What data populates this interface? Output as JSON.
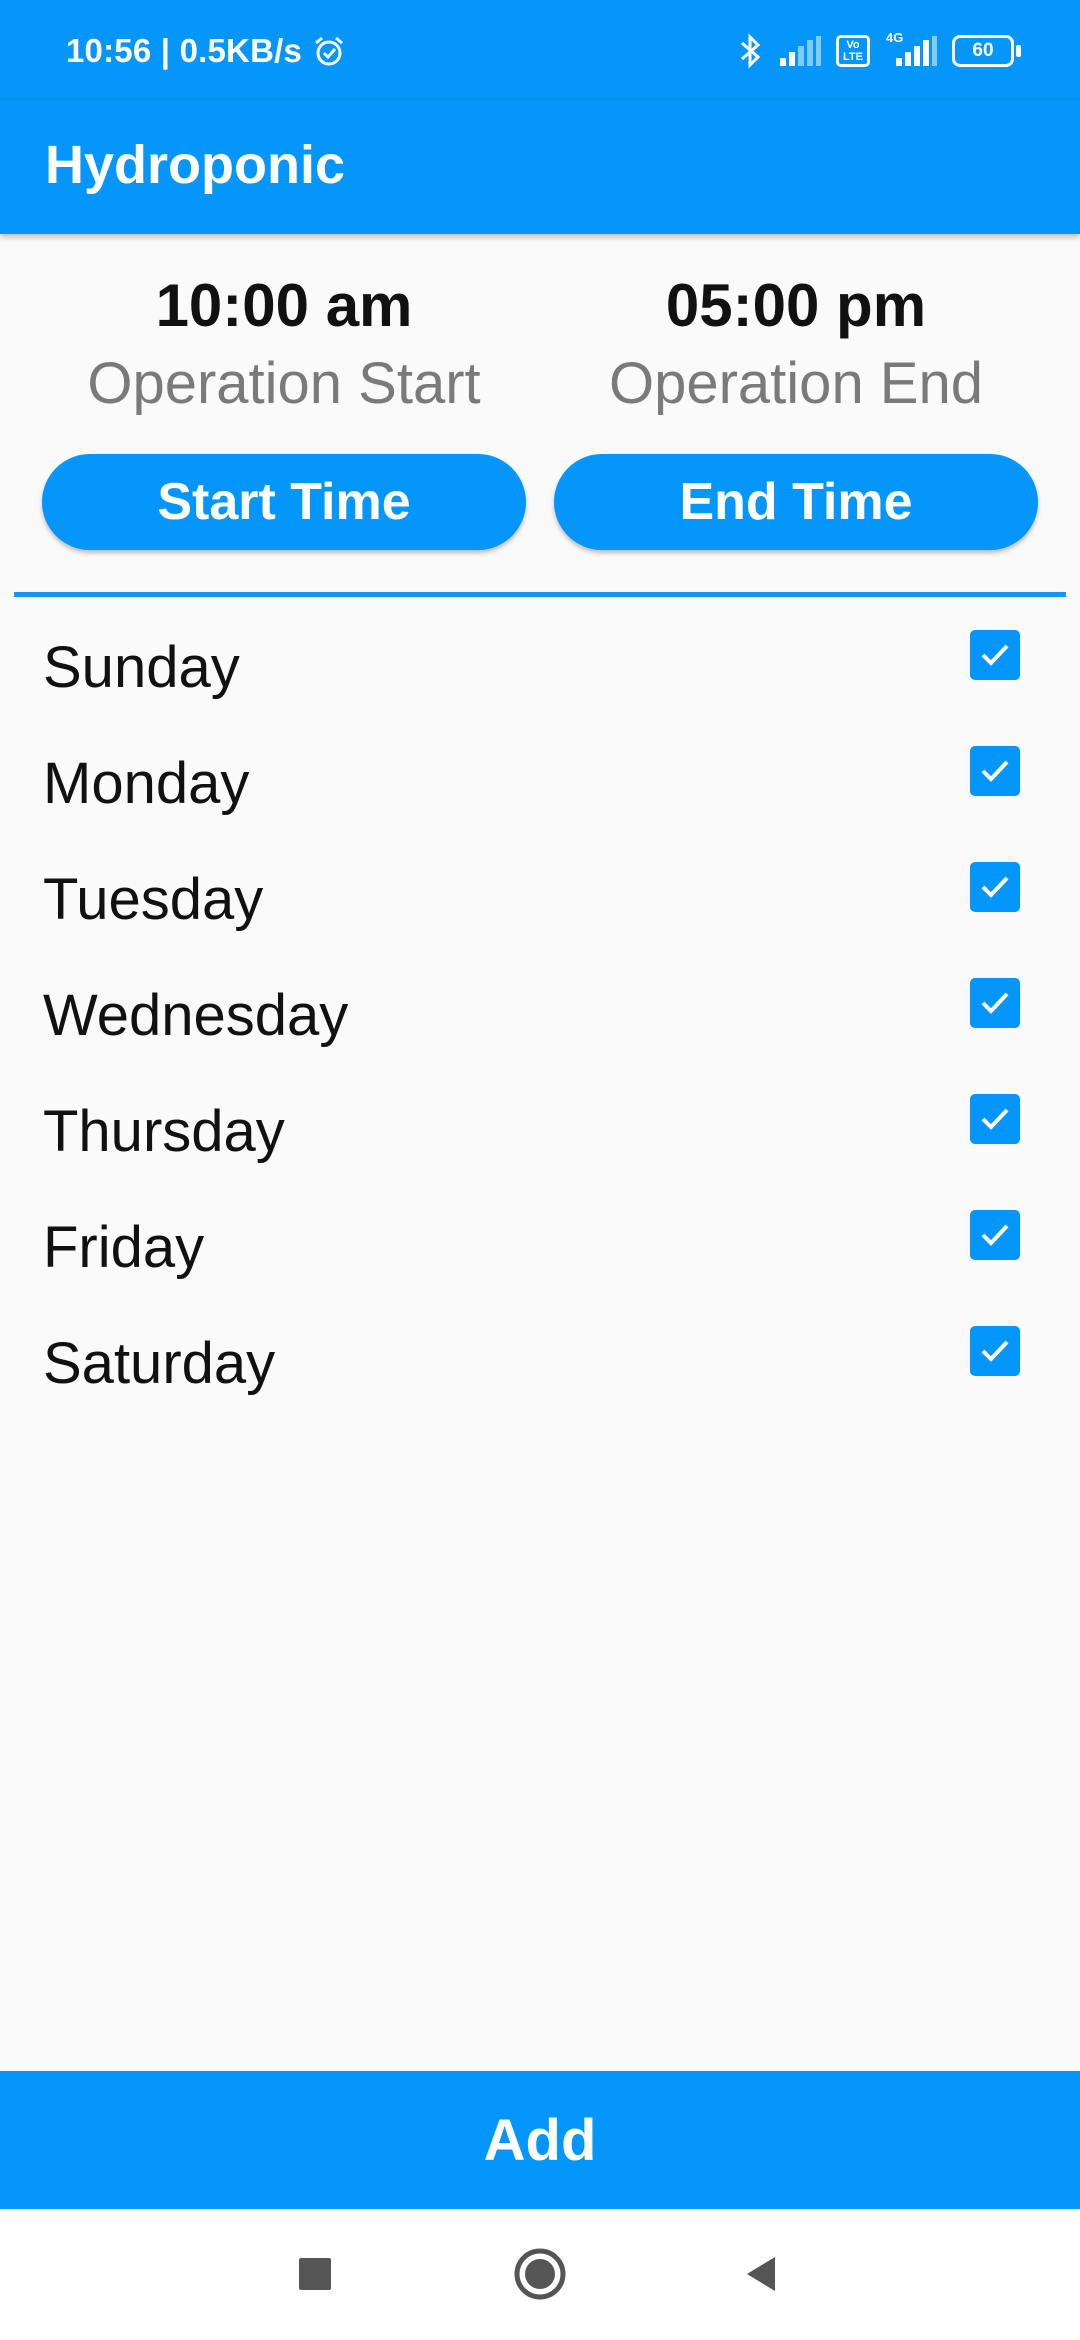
{
  "status_bar": {
    "time_speed": "10:56 | 0.5KB/s",
    "network_4g": "4G",
    "volte": "Vo LTE",
    "battery": "60",
    "icons": [
      "alarm-icon",
      "bluetooth-icon",
      "signal-icon",
      "volte-icon",
      "signal-4g-icon",
      "battery-icon"
    ]
  },
  "app_bar": {
    "title": "Hydroponic"
  },
  "schedule": {
    "start_time": "10:00 am",
    "start_caption": "Operation Start",
    "end_time": "05:00 pm",
    "end_caption": "Operation End",
    "start_button": "Start Time",
    "end_button": "End Time"
  },
  "days": [
    {
      "label": "Sunday",
      "checked": true
    },
    {
      "label": "Monday",
      "checked": true
    },
    {
      "label": "Tuesday",
      "checked": true
    },
    {
      "label": "Wednesday",
      "checked": true
    },
    {
      "label": "Thursday",
      "checked": true
    },
    {
      "label": "Friday",
      "checked": true
    },
    {
      "label": "Saturday",
      "checked": true
    }
  ],
  "add_button": "Add",
  "nav": [
    "recents-icon",
    "home-icon",
    "back-icon"
  ],
  "colors": {
    "primary": "#0496fb",
    "background": "#fafafa",
    "caption": "#7a7a7a"
  }
}
